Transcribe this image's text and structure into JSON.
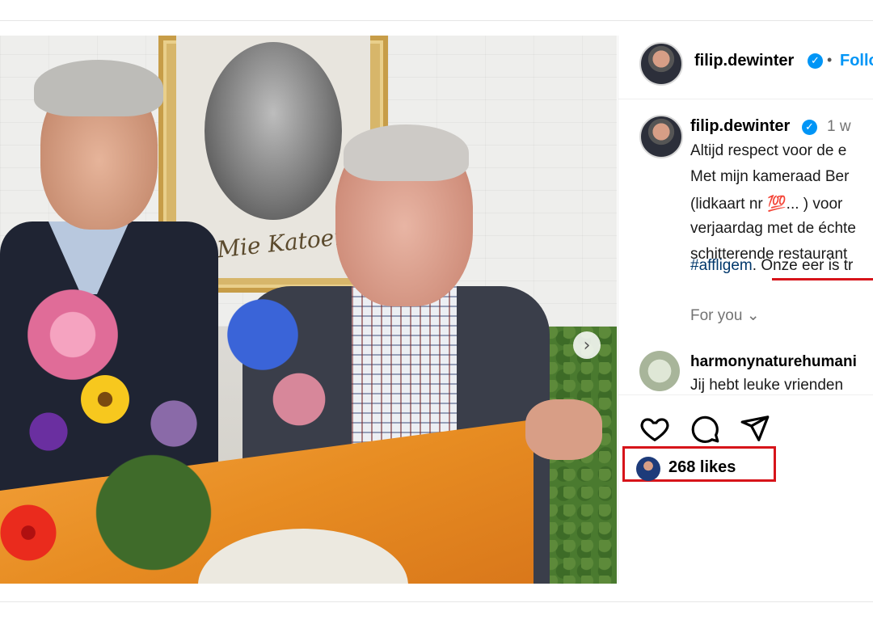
{
  "post": {
    "image_alt": "",
    "portrait_caption": "Mie Katoen"
  },
  "header": {
    "username": "filip.dewinter",
    "separator": "•",
    "follow_label": "Follo"
  },
  "caption": {
    "username": "filip.dewinter",
    "time": "1 w",
    "lines": [
      "Altijd respect voor de e",
      "Met mijn kameraad Ber",
      "(lidkaart nr 💯... ) voor",
      "verjaardag met de échte",
      "schitterende restaurant"
    ],
    "hashtag": "#affligem",
    "tail": ". Onze eer is tr"
  },
  "for_you": {
    "label": "For you"
  },
  "comment": {
    "username": "harmonynaturehumani",
    "text": "Jij hebt leuke vrienden"
  },
  "likes": {
    "count_text": "268 likes"
  },
  "icons": {
    "like": "heart-icon",
    "comment": "comment-icon",
    "share": "send-icon",
    "next": "chevron-right-icon",
    "verified": "verified-badge-icon"
  },
  "colors": {
    "link_blue": "#0095f6",
    "hashtag": "#00376b",
    "highlight_red": "#d7141a",
    "flag_orange": "#e78c22"
  }
}
